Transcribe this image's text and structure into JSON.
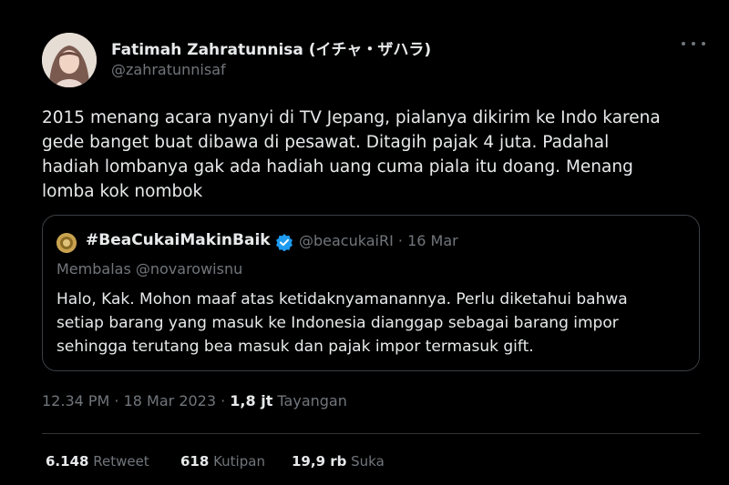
{
  "author": {
    "name": "Fatimah Zahratunnisa (イチャ・ザハラ)",
    "handle": "@zahratunnisaf"
  },
  "tweet": {
    "lines": [
      "2015 menang acara nyanyi di TV Jepang, pialanya dikirim ke Indo karena",
      "gede banget buat dibawa di pesawat. Ditagih pajak 4 juta. Padahal",
      "hadiah lombanya gak ada hadiah uang cuma piala itu doang. Menang",
      "lomba kok nombok"
    ]
  },
  "quote": {
    "name": "#BeaCukaiMakinBaik",
    "handle_date": "@beacukaiRI · 16 Mar",
    "reply_to": "Membalas @novarowisnu",
    "lines": [
      "Halo, Kak. Mohon maaf atas ketidaknyamanannya. Perlu diketahui bahwa",
      "setiap barang yang masuk ke Indonesia dianggap sebagai barang impor",
      "sehingga terutang bea masuk dan pajak impor termasuk gift."
    ]
  },
  "meta": {
    "time": "12.34 PM · 18 Mar 2023 · ",
    "views_count": "1,8 jt",
    "views_label": " Tayangan"
  },
  "stats": {
    "retweets_count": "6.148",
    "retweets_label": " Retweet",
    "quotes_count": "618",
    "quotes_label": " Kutipan",
    "likes_count": "19,9 rb",
    "likes_label": " Suka"
  },
  "colors": {
    "background": "#000000",
    "text_primary": "#e7e9ea",
    "text_secondary": "#71767b",
    "verified": "#1d9bf0",
    "border": "#3a3f44"
  },
  "icons": {
    "more": "more-dots-icon",
    "verified": "verified-badge-icon"
  }
}
